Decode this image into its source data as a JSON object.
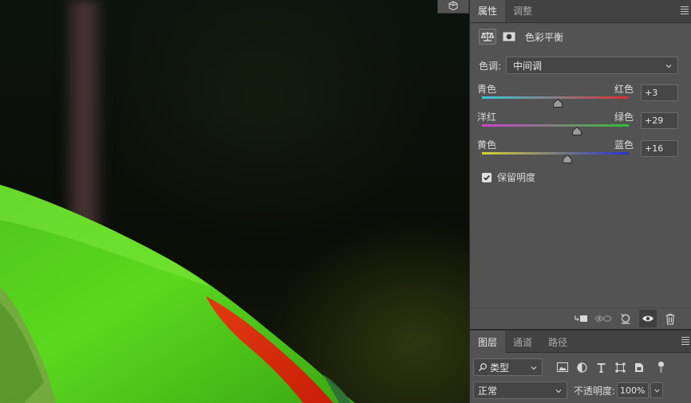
{
  "canvas": {
    "panel_toggle_icon": "cube-icon"
  },
  "properties_panel": {
    "tabs": [
      {
        "label": "属性",
        "active": true
      },
      {
        "label": "调整",
        "active": false
      }
    ],
    "adjustment_icon": "balance-scale-icon",
    "mask_icon": "layer-mask-icon",
    "title": "色彩平衡",
    "tone": {
      "label": "色调:",
      "value": "中间调"
    },
    "sliders": [
      {
        "left": "青色",
        "right": "红色",
        "value": "+3",
        "fraction": 0.515,
        "gradient": [
          "#38c8d8",
          "#d83030"
        ]
      },
      {
        "left": "洋红",
        "right": "绿色",
        "value": "+29",
        "fraction": 0.645,
        "gradient": [
          "#d040d0",
          "#30c030"
        ]
      },
      {
        "left": "黄色",
        "right": "蓝色",
        "value": "+16",
        "fraction": 0.58,
        "gradient": [
          "#d8d030",
          "#2830d0"
        ]
      }
    ],
    "preserve_luminosity": {
      "label": "保留明度",
      "checked": true
    },
    "footer_icons": [
      "clip-to-layer-icon",
      "view-previous-state-icon",
      "reset-icon",
      "visibility-eye-icon",
      "delete-icon"
    ]
  },
  "layers_panel": {
    "tabs": [
      {
        "label": "图层",
        "active": true
      },
      {
        "label": "通道",
        "active": false
      },
      {
        "label": "路径",
        "active": false
      }
    ],
    "filter": {
      "label": "类型",
      "icon": "search-icon"
    },
    "filter_icons": [
      "image-filter-icon",
      "adjustment-filter-icon",
      "type-filter-icon",
      "shape-filter-icon",
      "smart-object-filter-icon"
    ],
    "blend_mode": "正常",
    "opacity_label": "不透明度:",
    "opacity_value": "100%"
  }
}
